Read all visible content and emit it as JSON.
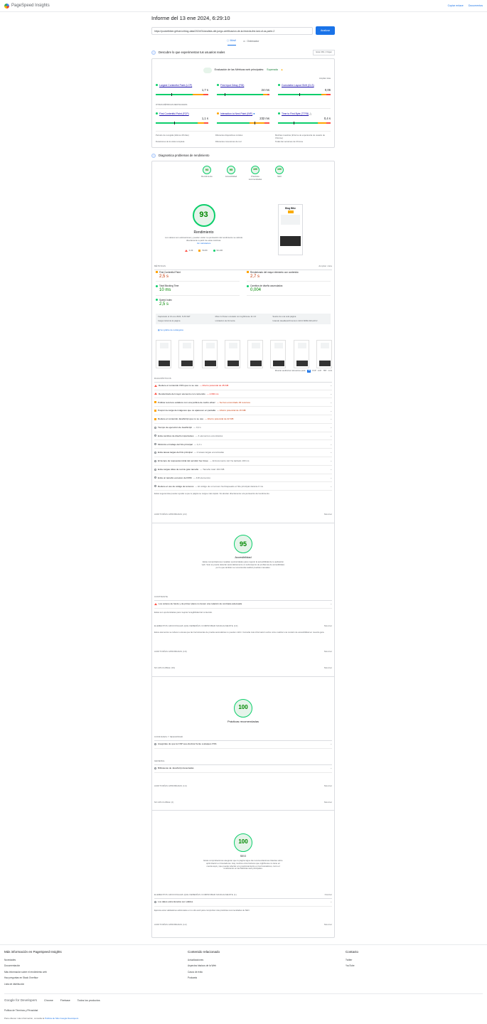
{
  "header": {
    "app_name": "PageSpeed Insights",
    "copy_link": "Copiar enlace",
    "docs": "Documentos"
  },
  "report": {
    "title": "Informe del 13 ene 2024, 6:29:10",
    "url": "https://pocketbiker.github.io/blog-data/2024/01/analisis-del-juego-certificacion-de-la-historia-the-last-of-us-parte-2",
    "analyze": "Analizar",
    "tab_mobile": "Móvil",
    "tab_desktop": "Ordenador"
  },
  "field": {
    "heading": "Descubre lo que experimentan tus usuarios reales",
    "origin_toggle_a": "Esta URL",
    "origin_toggle_b": "Origen",
    "cwv_label": "Evaluación de las Métricas web principales:",
    "cwv_status": "Superada",
    "expand": "Ampliar vista",
    "lcp": {
      "name": "Largest Contentful Paint (LCP)",
      "value": "1,7 s"
    },
    "fid": {
      "name": "First Input Delay (FID)",
      "value": "24 ms"
    },
    "cls": {
      "name": "Cumulative Layout Shift (CLS)",
      "value": "0,06"
    },
    "other_label": "OTRAS MÉTRICAS DESTACADAS",
    "fcp": {
      "name": "First Contentful Paint (FCP)",
      "value": "1,1 s"
    },
    "inp": {
      "name": "Interaction to Next Paint (INP)",
      "value": "232 ms"
    },
    "ttfb": {
      "name": "Time to First Byte (TTFB)",
      "value": "0,4 s"
    },
    "info": [
      "Período de recogida (últimos 28 días)",
      "Diferentes dispositivos móviles",
      "Muchas muestras (Informe de experiencia de usuario de Chrome)",
      "Duraciones de la visita completa",
      "Diferentes conexiones de red",
      "Todas las versiones de Chrome"
    ]
  },
  "lab": {
    "heading": "Diagnostica problemas de rendimiento",
    "scores": [
      {
        "value": "93",
        "label": "Rendimiento"
      },
      {
        "value": "95",
        "label": "Accesibilidad"
      },
      {
        "value": "100",
        "label": "Prácticas recomendadas"
      },
      {
        "value": "100",
        "label": "SEO"
      }
    ],
    "perf_title": "Rendimiento",
    "perf_note": "Los valores son estimaciones y pueden variar. La puntuación del rendimiento se calcula directamente a partir de estas métricas.",
    "perf_link": "Ver calculadora",
    "legend": [
      "0-49",
      "50-89",
      "90-100"
    ],
    "screenshot_title": "Blog Blitz",
    "metrics_label": "MÉTRICAS",
    "expand_view": "Ampliar vista",
    "m_fcp": {
      "name": "First Contentful Paint",
      "value": "2,5 s"
    },
    "m_lcp": {
      "name": "Renderizado del mayor elemento con contenido",
      "value": "2,7 s"
    },
    "m_tbt": {
      "name": "Total Blocking Time",
      "value": "10 ms"
    },
    "m_cls": {
      "name": "Cambios de diseño acumulados",
      "value": "0,004"
    },
    "m_si": {
      "name": "Speed Index",
      "value": "2,5 s"
    },
    "env": [
      "Capturado el 13 ene 2024, 6:29 CET",
      "Moto G Power emulado con Lighthouse 11.4.0",
      "Sesión de una sola página",
      "Carga inicial de la página",
      "Limitación de 4G lenta",
      "Usando HeadlessChromium 120.0.6099.199 with lr"
    ],
    "treemap": "Ver gráfico de rectángulos",
    "show_audits": "Mostrar auditorías relevantes para:",
    "filters": [
      "All",
      "FCP",
      "LCP",
      "TBT",
      "CLS"
    ],
    "diag_label": "DIAGNÓSTICOS",
    "audits": [
      {
        "title": "Reduce el contenido CSS que no se usa",
        "detail": "— Ahorro potencial de 45 KiB",
        "level": "red"
      },
      {
        "title": "Renderizado del mayor elemento con contenido",
        "detail": "— 2.660 ms",
        "level": "red"
      },
      {
        "title": "Publica recursos estáticos con una política de caché eficaz",
        "detail": "— Se han encontrado 29 recursos",
        "level": "orange"
      },
      {
        "title": "Pospón la carga de imágenes que no aparecen en pantalla",
        "detail": "— Ahorro potencial de 15 KiB",
        "level": "orange"
      },
      {
        "title": "Reduce el contenido JavaScript que no se usa",
        "detail": "— Ahorro potencial de 22 KiB",
        "level": "orange"
      },
      {
        "title": "Tiempo de ejecución de JavaScript",
        "detail": "— 0,0 s",
        "level": "info"
      },
      {
        "title": "Evita cambios de diseño importantes",
        "detail": "— 3 elementos encontrados",
        "level": "info"
      },
      {
        "title": "Minimiza el trabajo del hilo principal",
        "detail": "— 1,2 s",
        "level": "info"
      },
      {
        "title": "Evita tareas largas del hilo principal",
        "detail": "— 2 tareas largas encontradas",
        "level": "info"
      },
      {
        "title": "El tiempo de respuesta inicial del servidor fue breve",
        "detail": "— El documento raíz ha tardado 100 ms",
        "level": "info"
      },
      {
        "title": "Evita cargas útiles de red de gran tamaño",
        "detail": "— Tamaño total: 464 KiB",
        "level": "info"
      },
      {
        "title": "Evita un tamaño excesivo de DOM",
        "detail": "— 418 elementos",
        "level": "info"
      },
      {
        "title": "Reduce el uso de código de terceros",
        "detail": "— El código de un tercero ha bloqueado el hilo principal durante 0 ms",
        "level": "info"
      }
    ],
    "diag_note": "Estas sugerencias pueden ayudar a que tu página se cargue más rápido. No afectan directamente a la puntuación del rendimiento.",
    "passed_perf": "AUDITORÍAS APROBADAS (22)",
    "show": "Mostrar",
    "a11y_title": "Accesibilidad",
    "a11y_note": "Estas comprobaciones resaltan oportunidades para mejorar la accesibilidad de tu aplicación web. Solo se puede detectar automáticamente un subconjunto de problemas de accesibilidad, por lo que también se recomienda realizar pruebas manuales.",
    "contrast_label": "CONTRASTE",
    "contrast_audit": "Los colores de fondo y de primer plano no tienen una relación de contraste adecuada",
    "contrast_note": "Estas son oportunidades para mejorar la legibilidad del contenido.",
    "manual_label": "ELEMENTOS ADICIONALES QUE DEBERÍAS COMPROBAR MANUALMENTE (10)",
    "manual_note": "Estos elementos se refieren a áreas que las herramientas de prueba automáticas no pueden cubrir. Consulta más información sobre cómo realizar una revisión de accesibilidad en nuestra guía.",
    "passed_a11y": "AUDITORÍAS APROBADAS (19)",
    "na_a11y": "NO APLICABLE (39)",
    "bp_title": "Prácticas recomendadas",
    "trust_label": "CONFIANZA Y SEGURIDAD",
    "bp_audit1": "Asegúrate de que la CSP sea efectiva frente a ataques XSS",
    "general_label": "GENERAL",
    "bp_audit2": "Bibliotecas de JavaScript detectadas",
    "passed_bp": "AUDITORÍAS APROBADAS (14)",
    "na_bp": "NO APLICABLE (2)",
    "seo_title": "SEO",
    "seo_note": "Estas comprobaciones aseguran que tu página sigue las recomendaciones básicas sobre optimización en buscadores. Hay muchos otros factores que Lighthouse no tiene en cuenta aquí y que pueden afectar a tu posicionamiento en los buscadores, como el rendimiento en las Métricas web principales.",
    "seo_manual": "ELEMENTOS ADICIONALES QUE DEBERÍAS COMPROBAR MANUALMENTE (1)",
    "seo_audit": "Los datos estructurados son válidos",
    "seo_manual_note": "Ejecuta estos validadores adicionales en tu sitio web para comprobar más prácticas recomendadas de SEO.",
    "passed_seo": "AUDITORÍAS APROBADAS (12)",
    "hide": "Ocultar"
  },
  "footer": {
    "col1_title": "Más información en PageSpeed Insights",
    "col1": [
      "Novedades",
      "Documentación",
      "Más información sobre el rendimiento web",
      "Haz preguntas en Stack Overflow",
      "Lista de distribución"
    ],
    "col2_title": "Contenido relacionado",
    "col2": [
      "Actualizaciones",
      "Aspectos básicos de la Web",
      "Casos de éxito",
      "Podcasts"
    ],
    "col3_title": "Contacto",
    "col3": [
      "Twitter",
      "YouTube"
    ],
    "g4d": "Google for Developers",
    "links": [
      "Chrome",
      "Firebase",
      "Todos los productos"
    ],
    "privacy": "Política de Términos y Privacidad",
    "more": "Para obtener más información, consulta la",
    "more_link": "Política de Sitio Google Developers"
  }
}
